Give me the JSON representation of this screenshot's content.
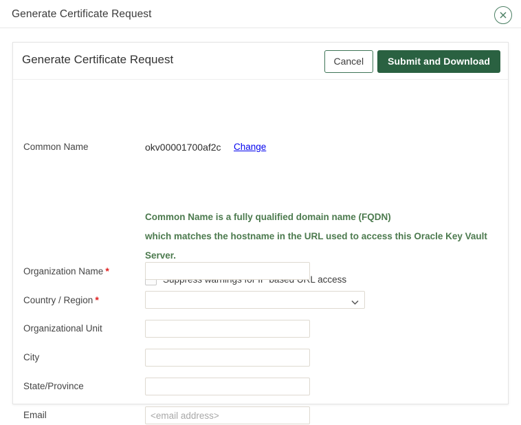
{
  "window": {
    "title": "Generate Certificate Request",
    "close_icon": "close-circle-icon"
  },
  "card": {
    "title": "Generate Certificate Request",
    "cancel_label": "Cancel",
    "submit_label": "Submit and Download"
  },
  "form": {
    "common_name": {
      "label": "Common Name",
      "value": "okv00001700af2c",
      "change_link": "Change"
    },
    "note": {
      "line1": "Common Name is a fully qualified domain name (FQDN)",
      "line2": "which matches the hostname in the URL used to access this Oracle Key Vault",
      "line3": "Server."
    },
    "suppress_warnings": {
      "label": "Suppress warnings for IP based URL access",
      "checked": false
    },
    "organization_name": {
      "label": "Organization Name",
      "required": "*",
      "value": "",
      "placeholder": ""
    },
    "country_region": {
      "label": "Country / Region",
      "required": "*",
      "value": "",
      "chevron_icon": "chevron-down-icon"
    },
    "organizational_unit": {
      "label": "Organizational Unit",
      "value": "",
      "placeholder": ""
    },
    "city": {
      "label": "City",
      "value": "",
      "placeholder": ""
    },
    "state_province": {
      "label": "State/Province",
      "value": "",
      "placeholder": ""
    },
    "email": {
      "label": "Email",
      "value": "",
      "placeholder": "<email address>"
    }
  },
  "colors": {
    "brand_green": "#2a6141",
    "note_green": "#4c7a4e",
    "required_red": "#e02020",
    "link_blue": "#0000ee"
  }
}
